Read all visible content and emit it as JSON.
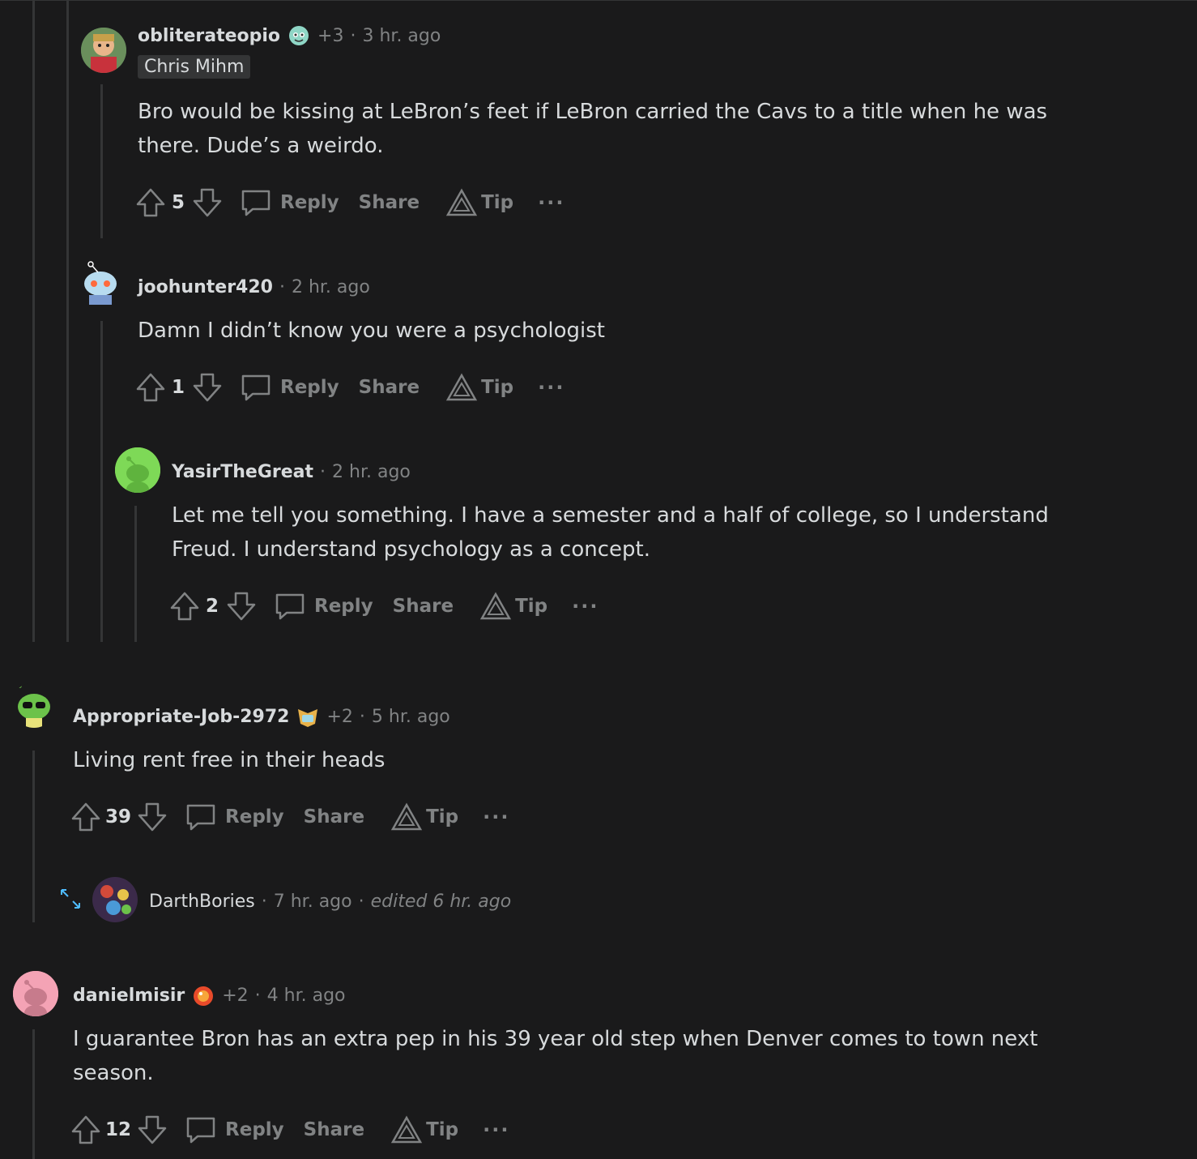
{
  "comments": [
    {
      "username": "obliterateopio",
      "plus": "+3",
      "time": "3 hr. ago",
      "flair": "Chris Mihm",
      "body": "Bro would be kissing at LeBron’s feet if LeBron carried the Cavs to a title when he was there. Dude’s a weirdo.",
      "score": "5"
    },
    {
      "username": "joohunter420",
      "time": "2 hr. ago",
      "body": "Damn I didn’t know you were a psychologist",
      "score": "1"
    },
    {
      "username": "YasirTheGreat",
      "time": "2 hr. ago",
      "body": "Let me tell you something. I have a semester and a half of college, so I understand Freud. I understand psychology as a concept.",
      "score": "2"
    },
    {
      "username": "Appropriate-Job-2972",
      "plus": "+2",
      "time": "5 hr. ago",
      "body": "Living rent free in their heads",
      "score": "39"
    },
    {
      "username": "DarthBories",
      "time": "7 hr. ago",
      "edited": "edited 6 hr. ago"
    },
    {
      "username": "danielmisir",
      "plus": "+2",
      "time": "4 hr. ago",
      "body": "I guarantee Bron has an extra pep in his 39 year old step when Denver comes to town next season.",
      "score": "12"
    }
  ],
  "actions": {
    "reply": "Reply",
    "share": "Share",
    "tip": "Tip",
    "more": "···"
  },
  "separator": "·",
  "colors": {
    "background": "#1a1a1b",
    "text": "#d7dadc",
    "muted": "#818384",
    "thread_line": "#343536",
    "expand_icon": "#4fbcff"
  }
}
